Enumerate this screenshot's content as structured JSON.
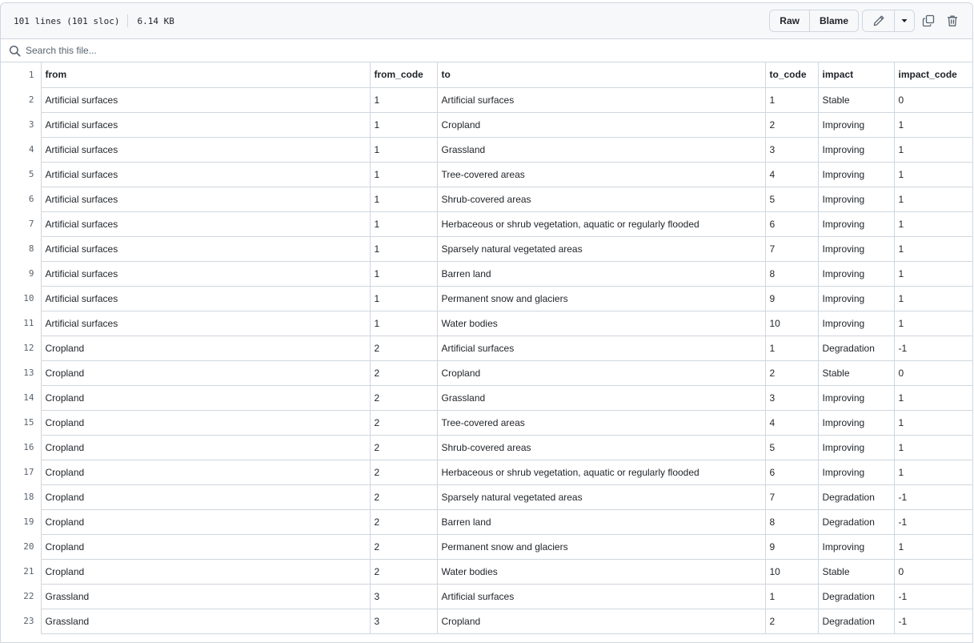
{
  "file": {
    "lines": "101 lines (101 sloc)",
    "size": "6.14 KB"
  },
  "toolbar": {
    "raw": "Raw",
    "blame": "Blame"
  },
  "search": {
    "placeholder": "Search this file..."
  },
  "icons": {
    "search": "search-icon",
    "edit": "pencil-icon",
    "caret": "triangle-down-icon",
    "copy": "copy-icon",
    "delete": "trash-icon"
  },
  "colors": {
    "border": "#d0d7de",
    "header_bg": "#f6f8fa",
    "muted_text": "#59636e",
    "text": "#1f2328"
  },
  "table": {
    "rows": [
      {
        "n": "1",
        "cells": [
          "from",
          "from_code",
          "to",
          "to_code",
          "impact",
          "impact_code"
        ]
      },
      {
        "n": "2",
        "cells": [
          "Artificial surfaces",
          "1",
          "Artificial surfaces",
          "1",
          "Stable",
          "0"
        ]
      },
      {
        "n": "3",
        "cells": [
          "Artificial surfaces",
          "1",
          "Cropland",
          "2",
          "Improving",
          "1"
        ]
      },
      {
        "n": "4",
        "cells": [
          "Artificial surfaces",
          "1",
          "Grassland",
          "3",
          "Improving",
          "1"
        ]
      },
      {
        "n": "5",
        "cells": [
          "Artificial surfaces",
          "1",
          "Tree-covered areas",
          "4",
          "Improving",
          "1"
        ]
      },
      {
        "n": "6",
        "cells": [
          "Artificial surfaces",
          "1",
          "Shrub-covered areas",
          "5",
          "Improving",
          "1"
        ]
      },
      {
        "n": "7",
        "cells": [
          "Artificial surfaces",
          "1",
          "Herbaceous or shrub vegetation, aquatic or regularly flooded",
          "6",
          "Improving",
          "1"
        ]
      },
      {
        "n": "8",
        "cells": [
          "Artificial surfaces",
          "1",
          "Sparsely natural vegetated areas",
          "7",
          "Improving",
          "1"
        ]
      },
      {
        "n": "9",
        "cells": [
          "Artificial surfaces",
          "1",
          "Barren land",
          "8",
          "Improving",
          "1"
        ]
      },
      {
        "n": "10",
        "cells": [
          "Artificial surfaces",
          "1",
          "Permanent snow and glaciers",
          "9",
          "Improving",
          "1"
        ]
      },
      {
        "n": "11",
        "cells": [
          "Artificial surfaces",
          "1",
          "Water bodies",
          "10",
          "Improving",
          "1"
        ]
      },
      {
        "n": "12",
        "cells": [
          "Cropland",
          "2",
          "Artificial surfaces",
          "1",
          "Degradation",
          "-1"
        ]
      },
      {
        "n": "13",
        "cells": [
          "Cropland",
          "2",
          "Cropland",
          "2",
          "Stable",
          "0"
        ]
      },
      {
        "n": "14",
        "cells": [
          "Cropland",
          "2",
          "Grassland",
          "3",
          "Improving",
          "1"
        ]
      },
      {
        "n": "15",
        "cells": [
          "Cropland",
          "2",
          "Tree-covered areas",
          "4",
          "Improving",
          "1"
        ]
      },
      {
        "n": "16",
        "cells": [
          "Cropland",
          "2",
          "Shrub-covered areas",
          "5",
          "Improving",
          "1"
        ]
      },
      {
        "n": "17",
        "cells": [
          "Cropland",
          "2",
          "Herbaceous or shrub vegetation, aquatic or regularly flooded",
          "6",
          "Improving",
          "1"
        ]
      },
      {
        "n": "18",
        "cells": [
          "Cropland",
          "2",
          "Sparsely natural vegetated areas",
          "7",
          "Degradation",
          "-1"
        ]
      },
      {
        "n": "19",
        "cells": [
          "Cropland",
          "2",
          "Barren land",
          "8",
          "Degradation",
          "-1"
        ]
      },
      {
        "n": "20",
        "cells": [
          "Cropland",
          "2",
          "Permanent snow and glaciers",
          "9",
          "Improving",
          "1"
        ]
      },
      {
        "n": "21",
        "cells": [
          "Cropland",
          "2",
          "Water bodies",
          "10",
          "Stable",
          "0"
        ]
      },
      {
        "n": "22",
        "cells": [
          "Grassland",
          "3",
          "Artificial surfaces",
          "1",
          "Degradation",
          "-1"
        ]
      },
      {
        "n": "23",
        "cells": [
          "Grassland",
          "3",
          "Cropland",
          "2",
          "Degradation",
          "-1"
        ]
      }
    ]
  }
}
